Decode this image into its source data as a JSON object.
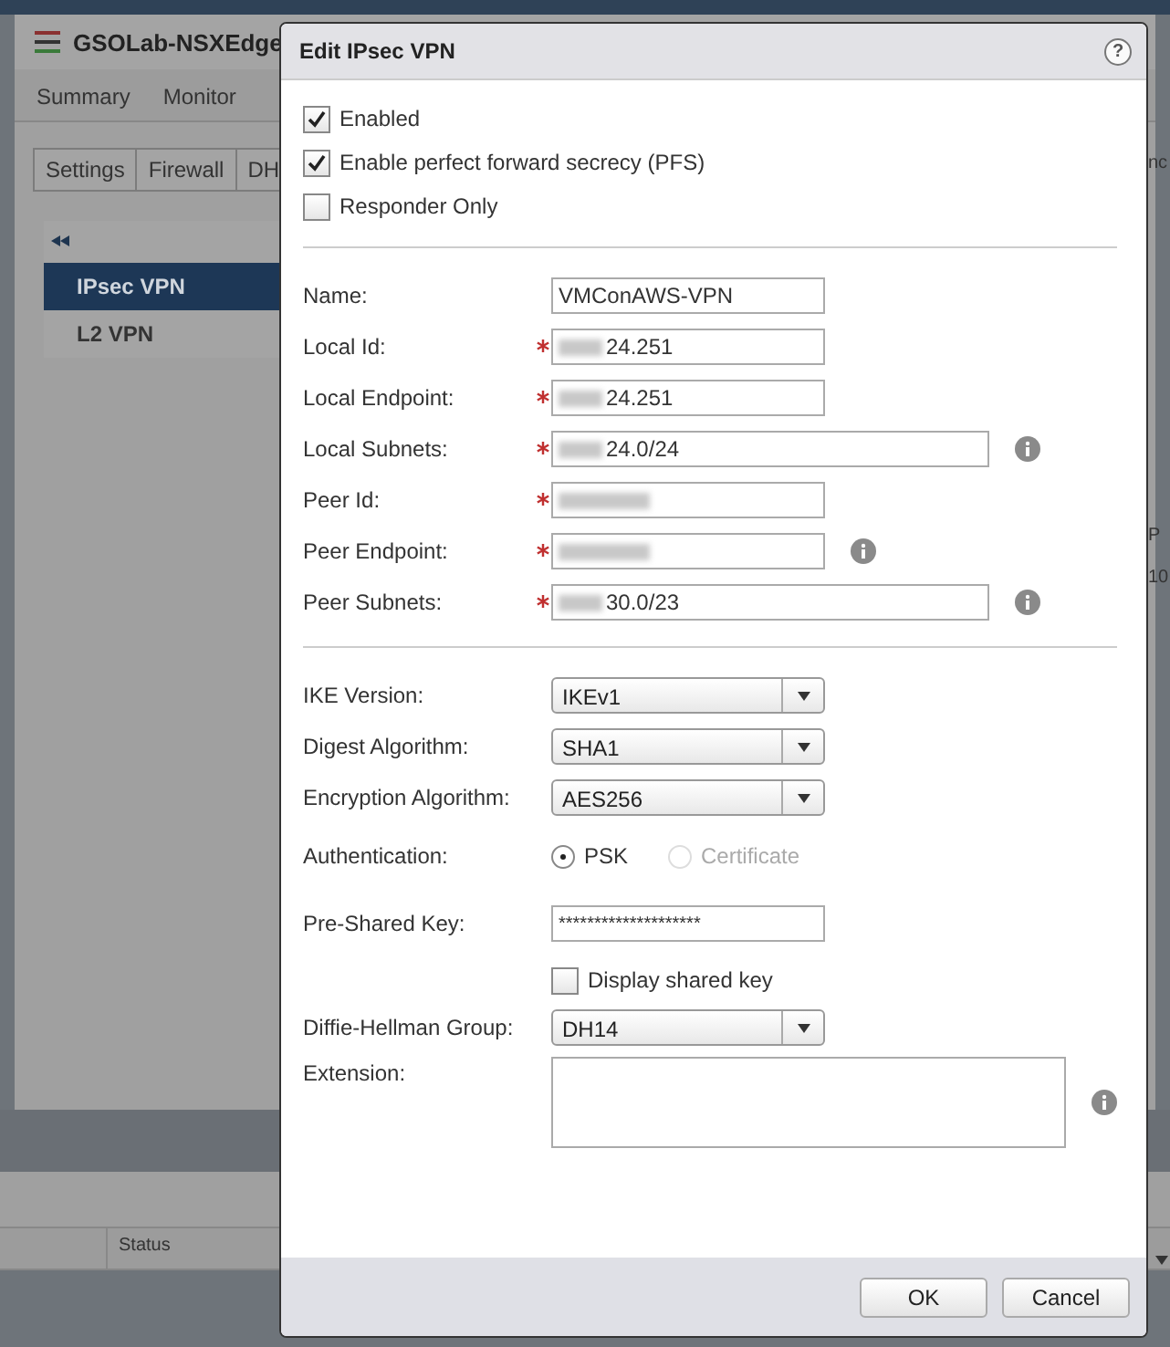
{
  "background": {
    "title": "GSOLab-NSXEdge",
    "tabs": [
      {
        "label": "Summary",
        "selected": false
      },
      {
        "label": "Monitor",
        "selected": false
      }
    ],
    "subtabs": [
      {
        "label": "Settings",
        "selected": false
      },
      {
        "label": "Firewall",
        "selected": false
      },
      {
        "label": "DH",
        "selected": false
      }
    ],
    "nav_items": [
      {
        "label": "IPsec VPN",
        "selected": true
      },
      {
        "label": "L2 VPN",
        "selected": false
      }
    ],
    "right_tab": "nc",
    "right_column": "P",
    "right_cell": "10",
    "table_columns": [
      "Status"
    ]
  },
  "dialog": {
    "title": "Edit IPsec VPN",
    "help": "?",
    "options": [
      {
        "label": "Enabled",
        "checked": true
      },
      {
        "label": "Enable perfect forward secrecy (PFS)",
        "checked": true
      },
      {
        "label": "Responder Only",
        "checked": false
      }
    ],
    "fields": [
      {
        "label": "Name:",
        "required": false,
        "value": "VMConAWS-VPN",
        "redacted": false,
        "wide": false,
        "info": false
      },
      {
        "label": "Local Id:",
        "required": true,
        "value": "24.251",
        "redacted": true,
        "wide": false,
        "info": false
      },
      {
        "label": "Local Endpoint:",
        "required": true,
        "value": "24.251",
        "redacted": true,
        "wide": false,
        "info": false
      },
      {
        "label": "Local Subnets:",
        "required": true,
        "value": "24.0/24",
        "redacted": true,
        "wide": true,
        "info": true
      },
      {
        "label": "Peer Id:",
        "required": true,
        "redacted": true,
        "wide": false,
        "info": false
      },
      {
        "label": "Peer Endpoint:",
        "required": true,
        "redacted": true,
        "wide": false,
        "info": true
      },
      {
        "label": "Peer Subnets:",
        "required": true,
        "value": "30.0/23",
        "redacted": true,
        "wide": true,
        "info": true
      }
    ],
    "settings": [
      {
        "kind": "select",
        "label": "IKE Version:",
        "value": "IKEv1"
      },
      {
        "kind": "select",
        "label": "Digest Algorithm:",
        "value": "SHA1"
      },
      {
        "kind": "select",
        "label": "Encryption Algorithm:",
        "value": "AES256"
      },
      {
        "kind": "radio",
        "label": "Authentication:",
        "options": [
          {
            "label": "PSK",
            "selected": true,
            "disabled": false
          },
          {
            "label": "Certificate",
            "selected": false,
            "disabled": true
          }
        ]
      },
      {
        "kind": "password",
        "label": "Pre-Shared Key:",
        "value": "********************"
      },
      {
        "kind": "checkbox",
        "label": "Display shared key",
        "checked": false
      },
      {
        "kind": "select",
        "label": "Diffie-Hellman Group:",
        "value": "DH14"
      },
      {
        "kind": "textarea",
        "label": "Extension:",
        "info": true
      }
    ],
    "buttons": [
      "OK",
      "Cancel"
    ]
  }
}
